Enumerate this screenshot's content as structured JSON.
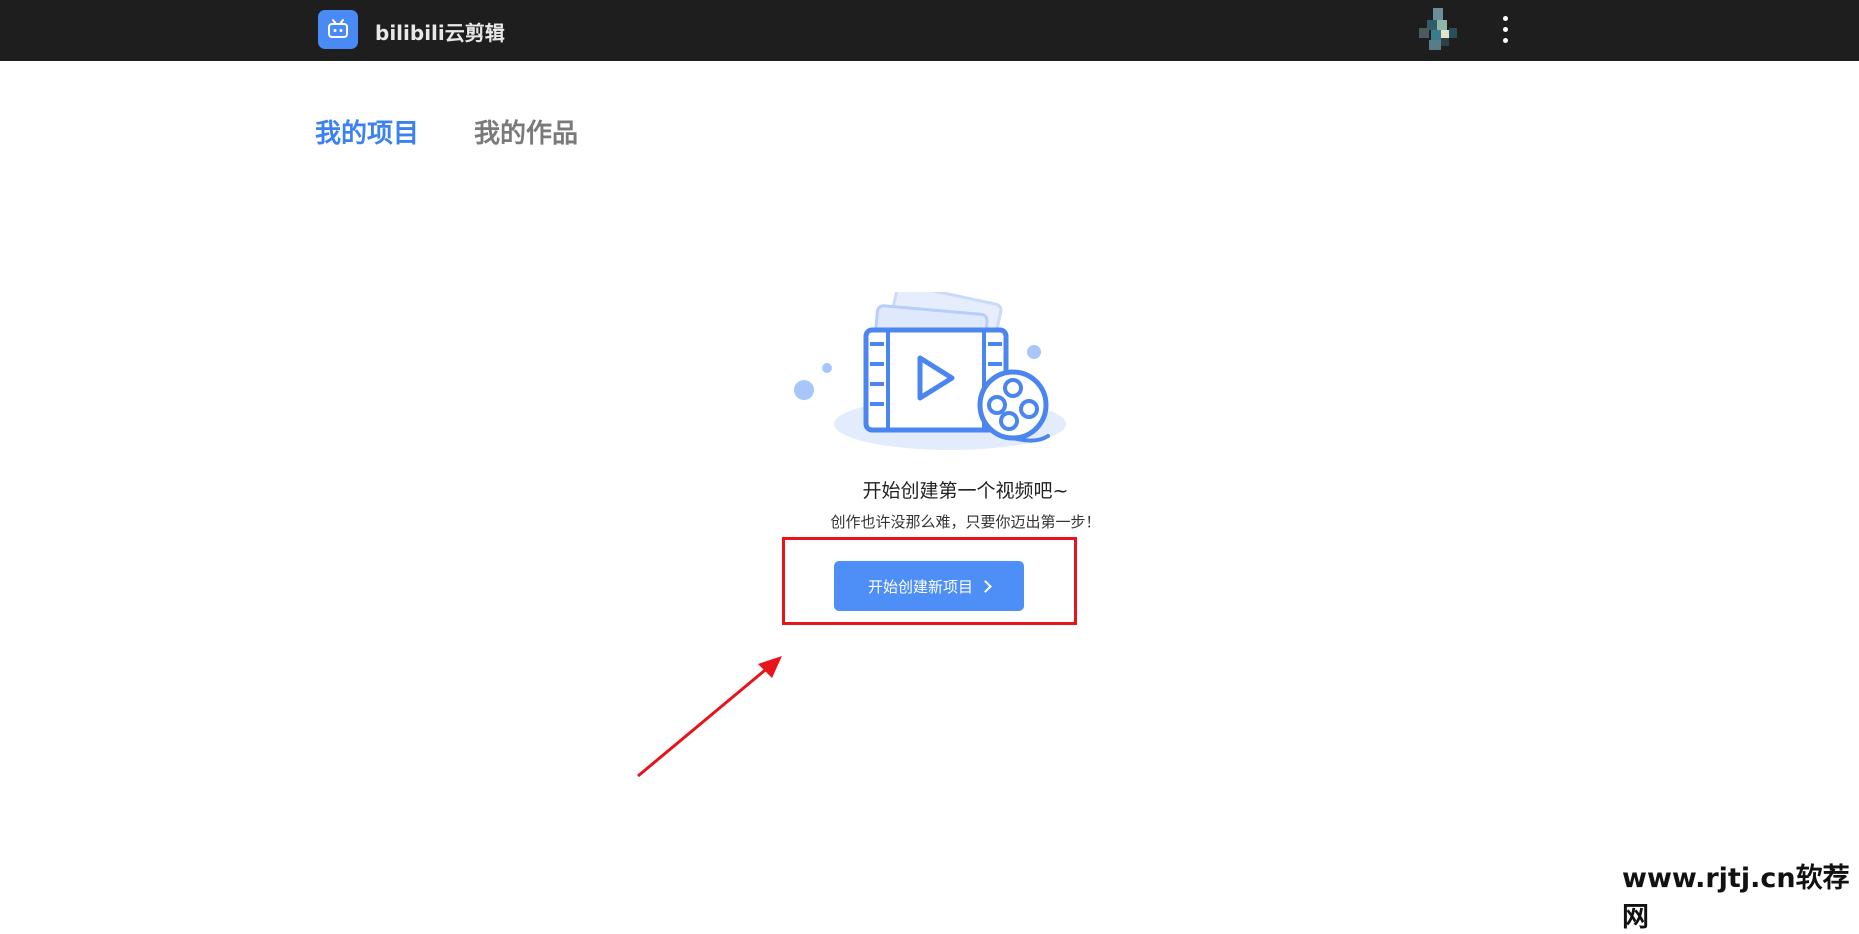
{
  "app": {
    "title": "bilibili云剪辑"
  },
  "tabs": [
    {
      "label": "我的项目",
      "active": true
    },
    {
      "label": "我的作品",
      "active": false
    }
  ],
  "empty_state": {
    "title": "开始创建第一个视频吧~",
    "subtitle": "创作也许没那么难，只要你迈出第一步！",
    "button_label": "开始创建新项目"
  },
  "icons": {
    "logo": "bilibili-tv-icon",
    "more": "more-vertical-icon",
    "button": "chevron-right-icon",
    "illustration": "video-reel-icon"
  },
  "colors": {
    "topbar": "#1e1e1e",
    "accent": "#3b82f0",
    "button": "#4d8ef7",
    "annotation": "#e8141b"
  },
  "watermark": "www.rjtj.cn软荐网"
}
